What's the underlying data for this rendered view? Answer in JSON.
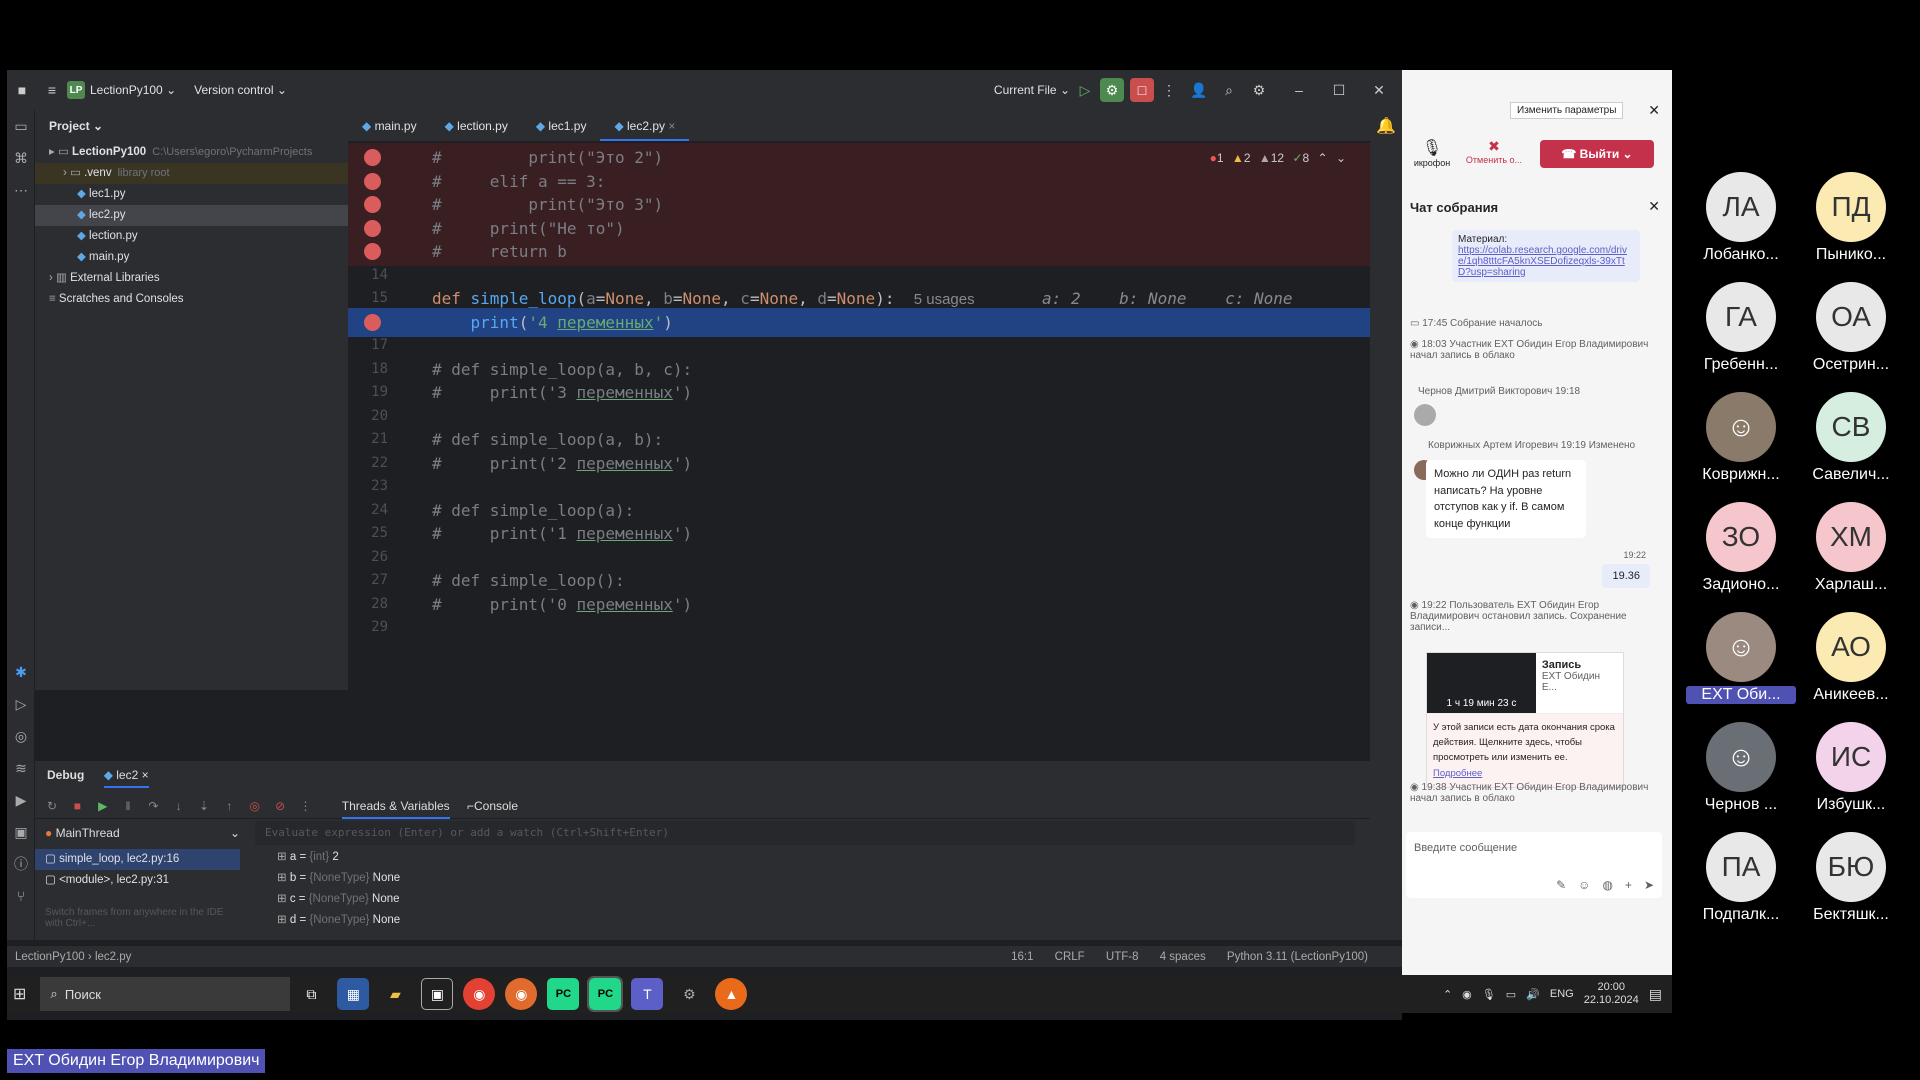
{
  "ide": {
    "project_badge": "LP",
    "project_name": "LectionPy100",
    "vcs": "Version control",
    "run_config": "Current File",
    "project_panel_title": "Project",
    "tree": [
      {
        "label": "LectionPy100",
        "extra": "C:\\Users\\egoro\\PycharmProjects",
        "indent": 0,
        "kind": "folder"
      },
      {
        "label": ".venv",
        "extra": "library root",
        "indent": 1,
        "kind": "venv"
      },
      {
        "label": "lec1.py",
        "extra": "",
        "indent": 2,
        "kind": "file"
      },
      {
        "label": "lec2.py",
        "extra": "",
        "indent": 2,
        "kind": "file-sel"
      },
      {
        "label": "lection.py",
        "extra": "",
        "indent": 2,
        "kind": "file"
      },
      {
        "label": "main.py",
        "extra": "",
        "indent": 2,
        "kind": "file"
      },
      {
        "label": "External Libraries",
        "extra": "",
        "indent": 0,
        "kind": "lib"
      },
      {
        "label": "Scratches and Consoles",
        "extra": "",
        "indent": 0,
        "kind": "scratch"
      }
    ],
    "tabs": [
      "main.py",
      "lection.py",
      "lec1.py",
      "lec2.py"
    ],
    "active_tab": "lec2.py",
    "inspections": {
      "errors": "1",
      "warnings": "2",
      "weak": "12",
      "ok": "8"
    },
    "code_lines": [
      {
        "n": "",
        "bp": true,
        "bg": "bp",
        "html": "<span class='cm'>#         print(\"Это 2\")</span>"
      },
      {
        "n": "",
        "bp": true,
        "bg": "bp",
        "html": "<span class='cm'>#     elif a == 3:</span>"
      },
      {
        "n": "",
        "bp": true,
        "bg": "bp",
        "html": "<span class='cm'>#         print(\"Это 3\")</span>"
      },
      {
        "n": "",
        "bp": true,
        "bg": "bp",
        "html": "<span class='cm'>#     print(\"Не то\")</span>"
      },
      {
        "n": "",
        "bp": true,
        "bg": "bp",
        "html": "<span class='cm'>#     return b</span>"
      },
      {
        "n": "14",
        "bp": false,
        "bg": "",
        "html": ""
      },
      {
        "n": "15",
        "bp": false,
        "bg": "",
        "html": "<span class='kw'>def </span><span class='fn'>simple_loop</span>(<span class='cm'>a</span>=<span class='kw'>None</span>, <span class='cm'>b</span>=<span class='kw'>None</span>, <span class='cm'>c</span>=<span class='kw'>None</span>, <span class='cm'>d</span>=<span class='kw'>None</span>):  <span class='usg'>5 usages</span>       <span class='hint'>a: 2    b: None    c: None</span>"
      },
      {
        "n": "",
        "bp": true,
        "bg": "cur",
        "html": "    <span class='fn'>print</span>(<span class='str'>'4 <span class=ul>переменных</span>'</span>)"
      },
      {
        "n": "17",
        "bp": false,
        "bg": "",
        "html": ""
      },
      {
        "n": "18",
        "bp": false,
        "bg": "",
        "html": "<span class='cm'># def simple_loop(a, b, c):</span>"
      },
      {
        "n": "19",
        "bp": false,
        "bg": "",
        "html": "<span class='cm'>#     print('3 <span class=ul>переменных</span>')</span>"
      },
      {
        "n": "20",
        "bp": false,
        "bg": "",
        "html": ""
      },
      {
        "n": "21",
        "bp": false,
        "bg": "",
        "html": "<span class='cm'># def simple_loop(a, b):</span>"
      },
      {
        "n": "22",
        "bp": false,
        "bg": "",
        "html": "<span class='cm'>#     print('2 <span class=ul>переменных</span>')</span>"
      },
      {
        "n": "23",
        "bp": false,
        "bg": "",
        "html": ""
      },
      {
        "n": "24",
        "bp": false,
        "bg": "",
        "html": "<span class='cm'># def simple_loop(a):</span>"
      },
      {
        "n": "25",
        "bp": false,
        "bg": "",
        "html": "<span class='cm'>#     print('1 <span class=ul>переменных</span>')</span>"
      },
      {
        "n": "26",
        "bp": false,
        "bg": "",
        "html": ""
      },
      {
        "n": "27",
        "bp": false,
        "bg": "",
        "html": "<span class='cm'># def simple_loop():</span>"
      },
      {
        "n": "28",
        "bp": false,
        "bg": "",
        "html": "<span class='cm'>#     print('0 <span class=ul>переменных</span>')</span>"
      },
      {
        "n": "29",
        "bp": false,
        "bg": "",
        "html": ""
      }
    ],
    "debug": {
      "title": "Debug",
      "session": "lec2",
      "tab_threads": "Threads & Variables",
      "tab_console": "Console",
      "thread": "MainThread",
      "eval_placeholder": "Evaluate expression (Enter) or add a watch (Ctrl+Shift+Enter)",
      "frames": [
        "simple_loop, lec2.py:16",
        "<module>, lec2.py:31"
      ],
      "frames_hint": "Switch frames from anywhere in the IDE with Ctrl+...",
      "vars": [
        {
          "name": "a",
          "type": "{int}",
          "value": "2"
        },
        {
          "name": "b",
          "type": "{NoneType}",
          "value": "None"
        },
        {
          "name": "c",
          "type": "{NoneType}",
          "value": "None"
        },
        {
          "name": "d",
          "type": "{NoneType}",
          "value": "None"
        }
      ]
    },
    "status": {
      "breadcrumb_project": "LectionPy100",
      "breadcrumb_file": "lec2.py",
      "position": "16:1",
      "line_sep": "CRLF",
      "encoding": "UTF-8",
      "indent": "4 spaces",
      "interpreter": "Python 3.11 (LectionPy100)"
    }
  },
  "taskbar": {
    "search": "Поиск",
    "lang": "ENG",
    "time": "20:00",
    "date": "22.10.2024"
  },
  "chat": {
    "settings_btn": "Изменить параметры",
    "mic_label": "икрофон",
    "cancel_label": "Отменить о...",
    "leave_btn": "Выйти",
    "title": "Чат собрания",
    "material_label": "Материал:",
    "material_link": "https://colab.research.google.com/drive/1qh8tttcFA5knXSEDofizeqxls-39xTtD?usp=sharing",
    "events": [
      {
        "time": "17:45",
        "text": "Собрание началось"
      },
      {
        "time": "18:03",
        "text": "Участник EXT Обидин Егор Владимирович начал запись в облако"
      }
    ],
    "msg1_author": "Чернов Дмитрий Викторович",
    "msg1_time": "19:18",
    "msg2_author": "Коврижных Артем Игоревич",
    "msg2_time": "19:19",
    "msg2_edited": "Изменено",
    "msg2_text": "Можно ли ОДИН раз return написать? На уровне отступов как у if. В самом конце функции",
    "my_time": "19:22",
    "my_text": "19.36",
    "event3_time": "19:22",
    "event3_text": "Пользователь EXT Обидин Егор Владимирович остановил запись. Сохранение записи...",
    "rec_title": "Запись",
    "rec_author": "EXT Обидин Е...",
    "rec_duration": "1 ч 19 мин 23 с",
    "rec_notice": "У этой записи есть дата окончания срока действия. Щелкните здесь, чтобы просмотреть или изменить ее.",
    "rec_more": "Подробнее",
    "event4_time": "19:38",
    "event4_text": "Участник EXT Обидин Егор Владимирович начал запись в облако",
    "input_placeholder": "Введите сообщение"
  },
  "participants": [
    {
      "initials": "ЛА",
      "name": "Лобанко...",
      "color": "#e8e8e8",
      "fg": "#333"
    },
    {
      "initials": "ПД",
      "name": "Пынико...",
      "color": "#fbeab2",
      "fg": "#333"
    },
    {
      "initials": "ГА",
      "name": "Гребенн...",
      "color": "#e8e8e8",
      "fg": "#333"
    },
    {
      "initials": "ОА",
      "name": "Осетрин...",
      "color": "#e8e8e8",
      "fg": "#333"
    },
    {
      "initials": "",
      "name": "Коврижн...",
      "color": "#8a7a6a",
      "fg": "#fff"
    },
    {
      "initials": "СВ",
      "name": "Савелич...",
      "color": "#d6eee0",
      "fg": "#333"
    },
    {
      "initials": "ЗО",
      "name": "Задионо...",
      "color": "#f5c7cc",
      "fg": "#333"
    },
    {
      "initials": "ХМ",
      "name": "Харлаш...",
      "color": "#f5c7cc",
      "fg": "#333"
    },
    {
      "initials": "",
      "name": "EXT Оби...",
      "color": "#9a8a80",
      "fg": "#fff"
    },
    {
      "initials": "АО",
      "name": "Аникеев...",
      "color": "#fbeab2",
      "fg": "#333"
    },
    {
      "initials": "",
      "name": "Чернов ...",
      "color": "#6a6f76",
      "fg": "#fff"
    },
    {
      "initials": "ИС",
      "name": "Избушк...",
      "color": "#f2d3ea",
      "fg": "#333"
    },
    {
      "initials": "ПА",
      "name": "Подпалк...",
      "color": "#e8e8e8",
      "fg": "#333"
    },
    {
      "initials": "БЮ",
      "name": "Бектяшк...",
      "color": "#e8e8e8",
      "fg": "#333"
    }
  ],
  "caption": "EXT Обидин Егор Владимирович"
}
